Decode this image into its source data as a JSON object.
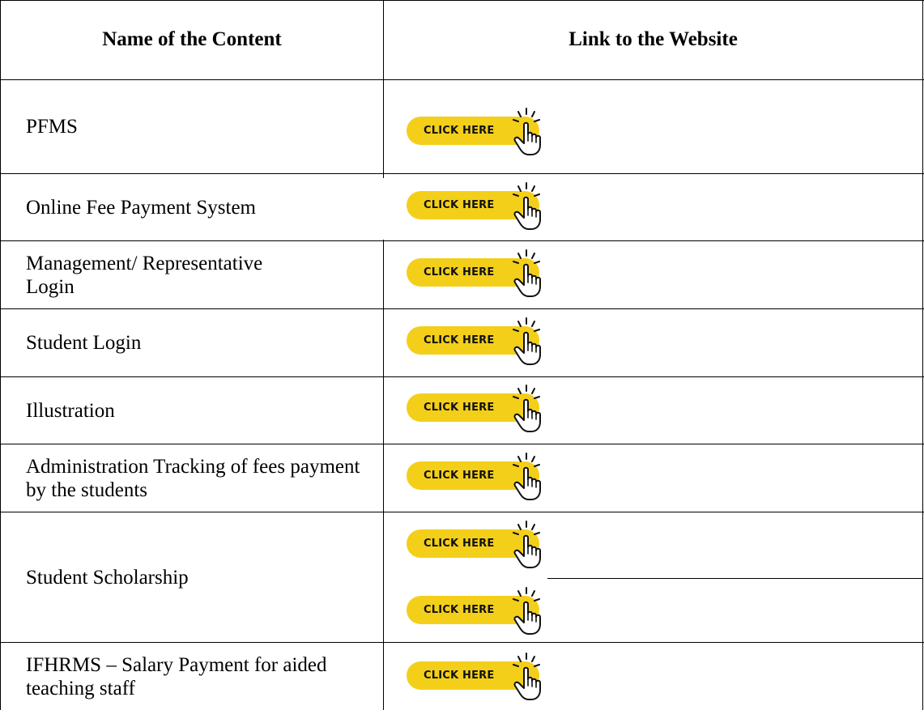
{
  "table": {
    "headers": {
      "content": "Name of the Content",
      "link": "Link to the Website"
    },
    "rows": [
      {
        "name": "PFMS",
        "buttons": [
          "CLICK HERE"
        ]
      },
      {
        "name": "Online Fee Payment System",
        "buttons": [
          "CLICK HERE"
        ]
      },
      {
        "name": "Management/ Representative Login",
        "buttons": [
          "CLICK HERE"
        ]
      },
      {
        "name": "Student Login",
        "buttons": [
          "CLICK HERE"
        ]
      },
      {
        "name": "Illustration",
        "buttons": [
          "CLICK HERE"
        ]
      },
      {
        "name": "Administration Tracking of fees payment by the students",
        "buttons": [
          "CLICK HERE"
        ]
      },
      {
        "name": "Student Scholarship",
        "buttons": [
          "CLICK HERE",
          "CLICK HERE"
        ]
      },
      {
        "name": "IFHRMS – Salary Payment for aided teaching staff",
        "buttons": [
          "CLICK HERE"
        ]
      }
    ]
  },
  "colors": {
    "button_fill": "#f3cf1a",
    "text": "#000000"
  },
  "icons": {
    "button_icon": "pointing-hand-click-icon"
  }
}
